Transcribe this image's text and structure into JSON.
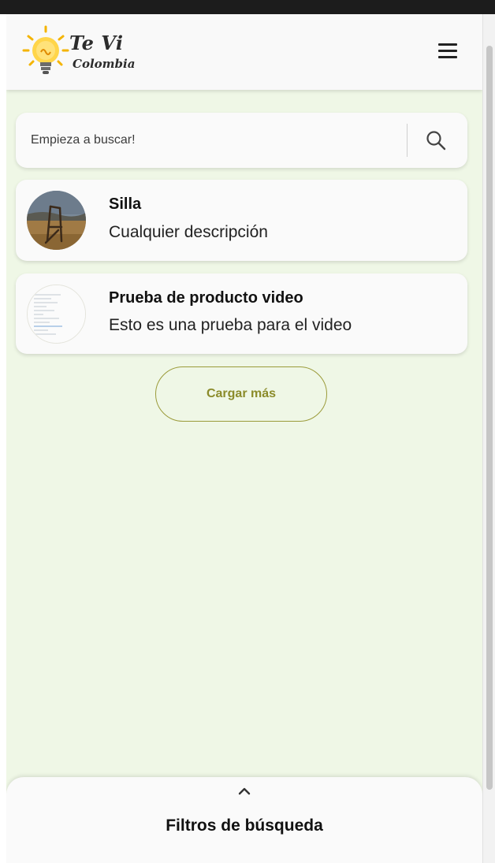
{
  "header": {
    "logo_line1": "Te Vi",
    "logo_line2": "Colombia"
  },
  "search": {
    "placeholder": "Empieza a buscar!"
  },
  "results": [
    {
      "title": "Silla",
      "description": "Cualquier descripción"
    },
    {
      "title": "Prueba de producto video",
      "description": "Esto es una prueba para el video"
    }
  ],
  "load_more_label": "Cargar más",
  "filters": {
    "title": "Filtros de búsqueda"
  },
  "colors": {
    "page_bg": "#eff7e6",
    "accent": "#8b8b2a",
    "card_bg": "#fafafa"
  },
  "icons": {
    "logo": "lightbulb-icon",
    "menu": "hamburger-menu-icon",
    "search": "search-icon",
    "filters": "chevron-up-icon"
  }
}
